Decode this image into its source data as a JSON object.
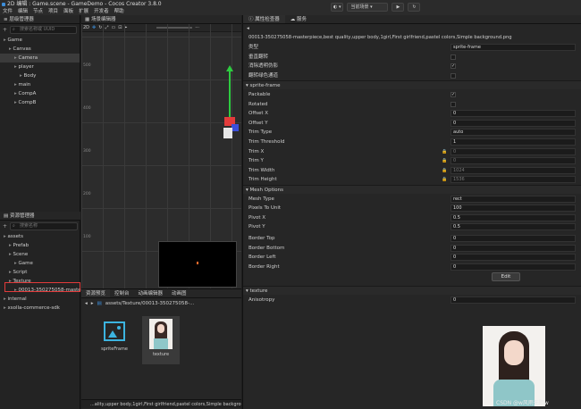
{
  "window": {
    "title": "2D 编辑 : Game.scene - GameDemo - Cocos Creator 3.8.0",
    "menu": [
      "文件",
      "编辑",
      "节点",
      "项目",
      "面板",
      "扩展",
      "开发者",
      "帮助"
    ],
    "scene_select": "当前场景"
  },
  "hierarchy": {
    "tab": "层级管理器",
    "search_placeholder": "搜索名称或 UUID",
    "items": [
      {
        "label": "Game",
        "indent": 0,
        "icon": "scene-icon"
      },
      {
        "label": "Canvas",
        "indent": 1
      },
      {
        "label": "Camera",
        "indent": 2,
        "selected": true
      },
      {
        "label": "player",
        "indent": 2
      },
      {
        "label": "Body",
        "indent": 3
      },
      {
        "label": "main",
        "indent": 2
      },
      {
        "label": "CompA",
        "indent": 2
      },
      {
        "label": "CompB",
        "indent": 2
      }
    ]
  },
  "assets": {
    "tab": "资源管理器",
    "search_placeholder": "搜索名称",
    "items": [
      {
        "label": "assets",
        "indent": 0
      },
      {
        "label": "Prefab",
        "indent": 1
      },
      {
        "label": "Scene",
        "indent": 1
      },
      {
        "label": "Game",
        "indent": 2
      },
      {
        "label": "Script",
        "indent": 1
      },
      {
        "label": "Texture",
        "indent": 1
      },
      {
        "label": "00013-350275058-master",
        "indent": 2
      },
      {
        "label": "internal",
        "indent": 0
      },
      {
        "label": "xsolla-commerce-sdk",
        "indent": 0
      }
    ]
  },
  "scene_editor": {
    "tab": "场景编辑器",
    "mode": "2D",
    "ruler_labels": [
      "500",
      "400",
      "300",
      "200",
      "100",
      "100",
      "500",
      "1000",
      "1500",
      "2000",
      "2500"
    ],
    "preview_tabs": [
      "资源预览",
      "控制台",
      "动画编辑器",
      "动画图"
    ]
  },
  "asset_preview": {
    "path": "assets/Texture/00013-350275058-...",
    "items": [
      {
        "label": "spriteFrame"
      },
      {
        "label": "texture"
      }
    ],
    "status": "...ality,upper body,1girl,First girlfriend,pastel colors,Simple background"
  },
  "inspector": {
    "tab": "属性检查器",
    "tab2": "服务",
    "filename": "00013-350275058-masterpiece,best quality,upper body,1girl,First girlfriend,pastel colors,Simple background.png",
    "rows": [
      {
        "label": "类型",
        "value": "sprite-frame",
        "kind": "text"
      },
      {
        "label": "垂直翻转",
        "kind": "check",
        "checked": false
      },
      {
        "label": "消除透明伪影",
        "kind": "check",
        "checked": true
      },
      {
        "label": "翻转绿色通道",
        "kind": "check",
        "checked": false
      }
    ],
    "section_sprite": "sprite-frame",
    "sprite_rows": [
      {
        "label": "Packable",
        "kind": "check",
        "checked": true
      },
      {
        "label": "Rotated",
        "kind": "check",
        "checked": false
      },
      {
        "label": "Offset X",
        "value": "0",
        "kind": "text"
      },
      {
        "label": "Offset Y",
        "value": "0",
        "kind": "text"
      },
      {
        "label": "Trim Type",
        "value": "auto",
        "kind": "text"
      },
      {
        "label": "Trim Threshold",
        "value": "1",
        "kind": "text"
      },
      {
        "label": "Trim X",
        "value": "0",
        "kind": "text",
        "locked": true
      },
      {
        "label": "Trim Y",
        "value": "0",
        "kind": "text",
        "locked": true
      },
      {
        "label": "Trim Width",
        "value": "1024",
        "kind": "text",
        "locked": true
      },
      {
        "label": "Trim Height",
        "value": "1536",
        "kind": "text",
        "locked": true
      }
    ],
    "mesh_section": "Mesh Options",
    "mesh_rows": [
      {
        "label": "Mesh Type",
        "value": "rect"
      },
      {
        "label": "Pixels To Unit",
        "value": "100"
      },
      {
        "label": "Pivot X",
        "value": "0.5"
      },
      {
        "label": "Pivot Y",
        "value": "0.5"
      }
    ],
    "border_rows": [
      {
        "label": "Border Top",
        "value": "0"
      },
      {
        "label": "Border Bottom",
        "value": "0"
      },
      {
        "label": "Border Left",
        "value": "0"
      },
      {
        "label": "Border Right",
        "value": "0"
      }
    ],
    "edit_button": "Edit",
    "texture_section": "texture",
    "anisotropy_label": "Anisotropy",
    "anisotropy_value": "0"
  },
  "watermark": "CSDN @w风雨无阻w",
  "colors": {
    "accent": "#3c8dd9",
    "axis_green": "#2ecc40",
    "axis_red": "#e23b3b",
    "highlight_box": "#e23b3b"
  }
}
